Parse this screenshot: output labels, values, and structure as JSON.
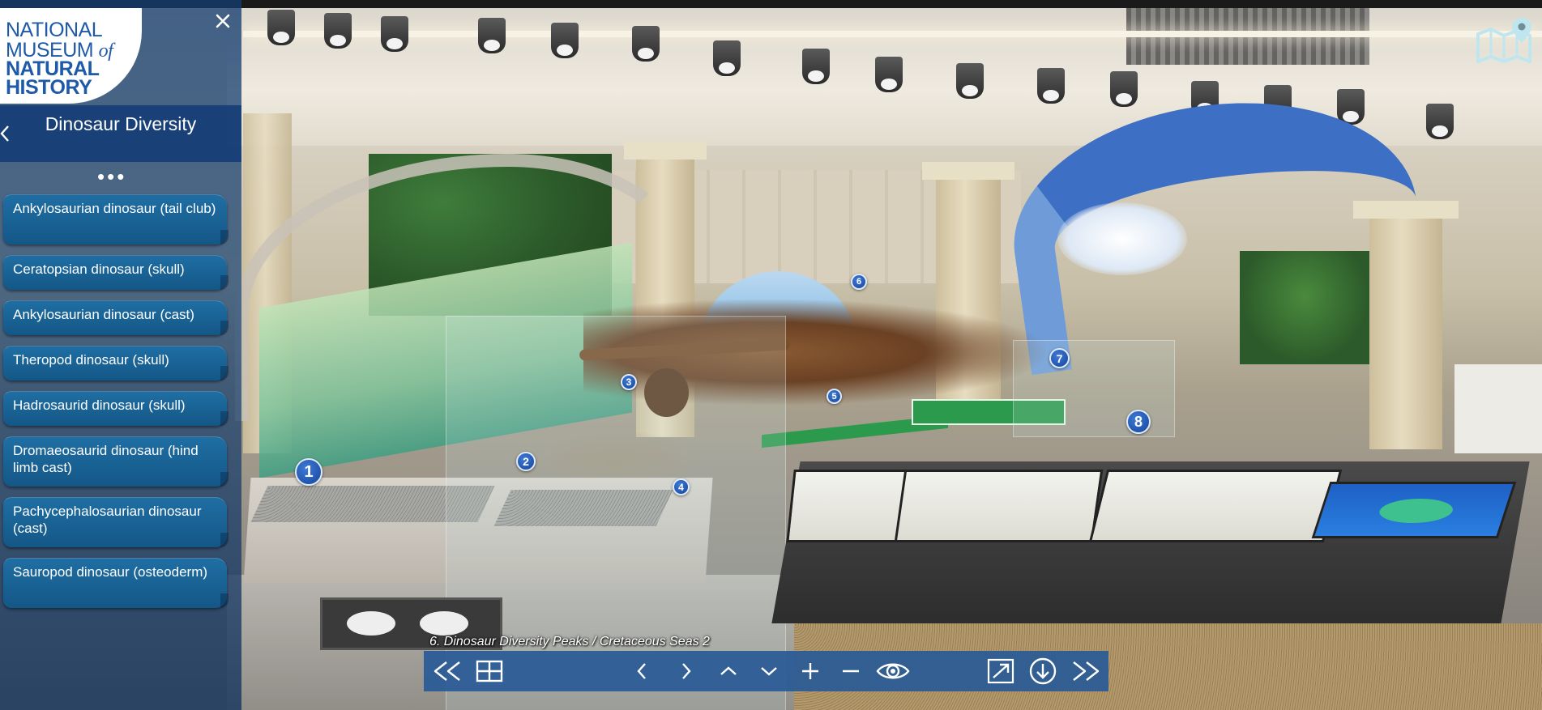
{
  "logo": {
    "line1": "NATIONAL",
    "line2": "MUSEUM",
    "line2_of": "of",
    "line3": "NATURAL",
    "line4": "HISTORY"
  },
  "sidebar": {
    "close_icon": "close-icon",
    "title": "Dinosaur Diversity",
    "more_dots": "•••",
    "items": [
      {
        "label": "Ankylosaurian dinosaur (tail club)"
      },
      {
        "label": "Ceratopsian dinosaur (skull)"
      },
      {
        "label": "Ankylosaurian dinosaur (cast)"
      },
      {
        "label": "Theropod dinosaur (skull)"
      },
      {
        "label": "Hadrosaurid dinosaur (skull)"
      },
      {
        "label": "Dromaeosaurid dinosaur (hind limb cast)"
      },
      {
        "label": "Pachycephalosaurian dinosaur (cast)"
      },
      {
        "label": "Sauropod dinosaur (osteoderm)"
      }
    ]
  },
  "hotspots": [
    {
      "label": "1"
    },
    {
      "label": "2"
    },
    {
      "label": "3"
    },
    {
      "label": "4"
    },
    {
      "label": "5"
    },
    {
      "label": "6"
    },
    {
      "label": "7"
    },
    {
      "label": "8"
    }
  ],
  "scene": {
    "caption": "6. Dinosaur Diversity Peaks / Cretaceous Seas 2"
  },
  "toolbar": {
    "buttons": [
      "rewind-icon",
      "grid-icon",
      "chevron-left-icon",
      "chevron-right-icon",
      "chevron-up-icon",
      "chevron-down-icon",
      "zoom-in-icon",
      "zoom-out-icon",
      "eye-icon",
      "fullscreen-icon",
      "download-icon",
      "fast-forward-icon"
    ]
  },
  "colors": {
    "sidebar": "#1e4678",
    "list_item": "#1a6496",
    "toolbar": "#285a96",
    "hotspot": "#1d4fa8",
    "logo_text": "#1e5aa8",
    "map_icon": "#bfe6ef"
  }
}
